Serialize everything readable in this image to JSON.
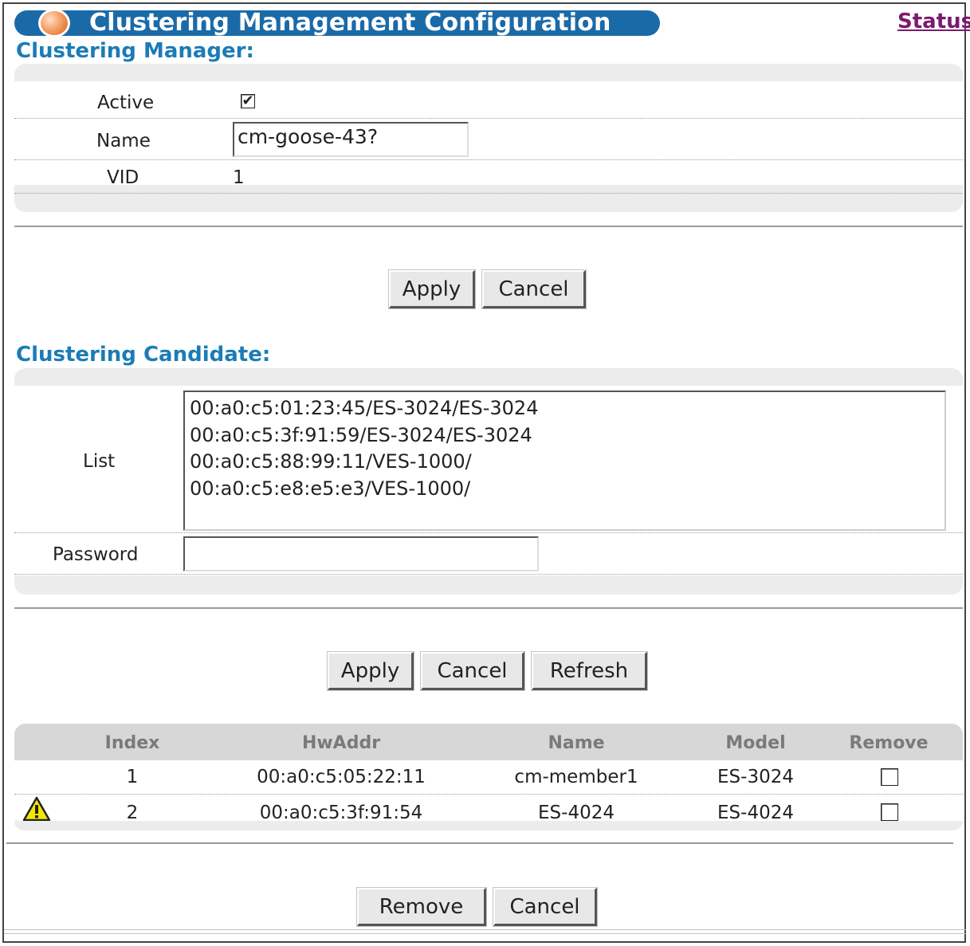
{
  "header": {
    "title": "Clustering Management Configuration",
    "status_link": "Status"
  },
  "manager": {
    "section_title": "Clustering Manager:",
    "active_label": "Active",
    "active_checked": true,
    "name_label": "Name",
    "name_value": "cm-goose-43?",
    "vid_label": "VID",
    "vid_value": "1",
    "apply_label": "Apply",
    "cancel_label": "Cancel"
  },
  "candidate": {
    "section_title": "Clustering Candidate:",
    "list_label": "List",
    "list_items": [
      "00:a0:c5:01:23:45/ES-3024/ES-3024",
      "00:a0:c5:3f:91:59/ES-3024/ES-3024",
      "00:a0:c5:88:99:11/VES-1000/",
      "00:a0:c5:e8:e5:e3/VES-1000/"
    ],
    "password_label": "Password",
    "password_value": "",
    "apply_label": "Apply",
    "cancel_label": "Cancel",
    "refresh_label": "Refresh"
  },
  "members": {
    "columns": [
      "Index",
      "HwAddr",
      "Name",
      "Model",
      "Remove"
    ],
    "rows": [
      {
        "index": "1",
        "hwaddr": "00:a0:c5:05:22:11",
        "name": "cm-member1",
        "model": "ES-3024",
        "remove_checked": false,
        "warning": false
      },
      {
        "index": "2",
        "hwaddr": "00:a0:c5:3f:91:54",
        "name": "ES-4024",
        "model": "ES-4024",
        "remove_checked": false,
        "warning": true
      }
    ],
    "remove_label": "Remove",
    "cancel_label": "Cancel"
  },
  "icons": {
    "warning": "warning-triangle-icon",
    "title_orb": "orb-icon"
  },
  "colors": {
    "title_bar": "#1b6aa8",
    "section_title": "#1b7cb6",
    "status_link": "#7b1b6e",
    "warning": "#f2e600"
  }
}
